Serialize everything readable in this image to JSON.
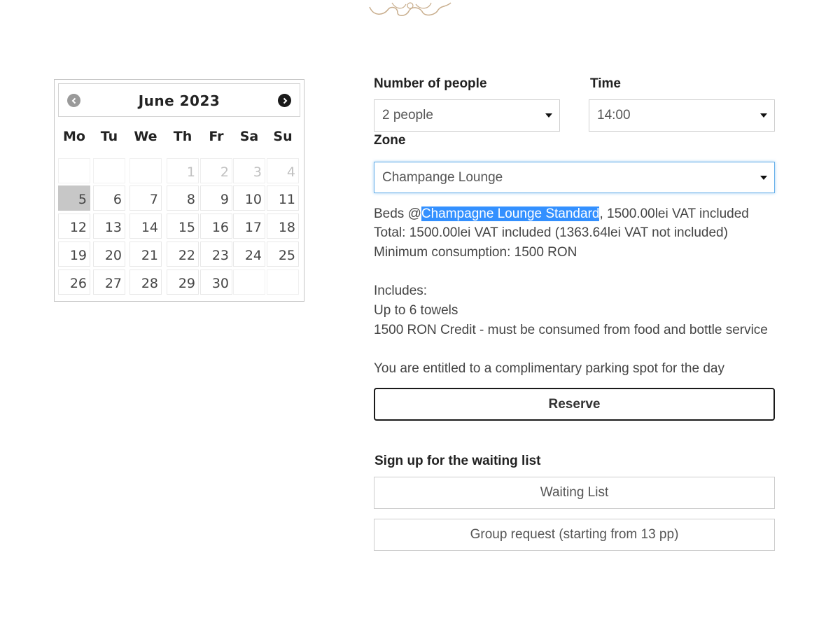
{
  "calendar": {
    "month_label": "June 2023",
    "prev_disabled": true,
    "weekdays": [
      "Mo",
      "Tu",
      "We",
      "Th",
      "Fr",
      "Sa",
      "Su"
    ],
    "weeks": [
      [
        "",
        "",
        "",
        "1",
        "2",
        "3",
        "4"
      ],
      [
        "5",
        "6",
        "7",
        "8",
        "9",
        "10",
        "11"
      ],
      [
        "12",
        "13",
        "14",
        "15",
        "16",
        "17",
        "18"
      ],
      [
        "19",
        "20",
        "21",
        "22",
        "23",
        "24",
        "25"
      ],
      [
        "26",
        "27",
        "28",
        "29",
        "30",
        "",
        ""
      ]
    ],
    "disabled_days": [
      "1",
      "2",
      "3",
      "4"
    ],
    "selected_day": "5"
  },
  "form": {
    "people_label": "Number of people",
    "people_value": "2 people",
    "time_label": "Time",
    "time_value": "14:00",
    "zone_label": "Zone",
    "zone_value": "Champange Lounge"
  },
  "details": {
    "beds_prefix": "Beds @",
    "beds_highlight": "Champagne Lounge Standard",
    "beds_suffix": ", 1500.00lei VAT included",
    "total": "Total: 1500.00lei VAT included (1363.64lei VAT not included)",
    "minimum": "Minimum consumption: 1500 RON",
    "includes_label": "Includes:",
    "include_1": "Up to 6 towels",
    "include_2": "1500 RON Credit - must be consumed from food and bottle service",
    "parking": "You are entitled to a complimentary parking spot for the day"
  },
  "actions": {
    "reserve_label": "Reserve",
    "waiting_heading": "Sign up for the waiting list",
    "waiting_label": "Waiting List",
    "group_label": "Group request (starting from 13 pp)"
  },
  "colors": {
    "selection": "#3390ff",
    "selected_day_bg": "#c7c7c7",
    "focus_border": "#66afe9"
  }
}
